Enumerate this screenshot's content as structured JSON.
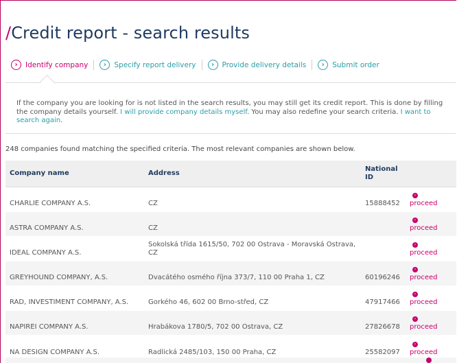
{
  "page": {
    "title_slash": "/",
    "title": "Credit report - search results"
  },
  "steps": [
    {
      "label": "Identify company",
      "icon": "chevron-right-circle-icon",
      "active": true
    },
    {
      "label": "Specify report delivery",
      "icon": "chevron-right-circle-icon",
      "active": false
    },
    {
      "label": "Provide delivery details",
      "icon": "chevron-right-circle-icon",
      "active": false
    },
    {
      "label": "Submit order",
      "icon": "chevron-right-circle-icon",
      "active": false
    }
  ],
  "notice": {
    "text1": "If the company you are looking for is not listed in the search results, you may still get its credit report. This is done by filling the company details yourself. ",
    "link1": "I will provide company details myself",
    "text2": ". You may also redefine your search criteria. ",
    "link2": "I want to search again",
    "text3": "."
  },
  "summary": "248 companies found matching the specified criteria. The most relevant companies are shown below.",
  "table": {
    "headers": {
      "name": "Company name",
      "address": "Address",
      "national_id": "National ID"
    },
    "rows": [
      {
        "name": "CHARLIE COMPANY A.S.",
        "address": "CZ",
        "national_id": "15888452",
        "action": "proceed"
      },
      {
        "name": "ASTRA COMPANY A.S.",
        "address": "CZ",
        "national_id": "",
        "action": "proceed"
      },
      {
        "name": "IDEAL COMPANY A.S.",
        "address": "Sokolská třída 1615/50, 702 00 Ostrava - Moravská Ostrava, CZ",
        "national_id": "",
        "action": "proceed"
      },
      {
        "name": "GREYHOUND COMPANY, A.S.",
        "address": "Dvacátého osmého října 373/7, 110 00 Praha 1, CZ",
        "national_id": "60196246",
        "action": "proceed"
      },
      {
        "name": "RAD, INVESTIMENT COMPANY, A.S.",
        "address": "Gorkého 46, 602 00 Brno-střed, CZ",
        "national_id": "47917466",
        "action": "proceed"
      },
      {
        "name": "NAPIREI COMPANY A.S.",
        "address": "Hrabákova 1780/5, 702 00 Ostrava, CZ",
        "national_id": "27826678",
        "action": "proceed"
      },
      {
        "name": "NA DESIGN COMPANY A.S.",
        "address": "Radlická 2485/103, 150 00 Praha, CZ",
        "national_id": "25582097",
        "action": "proceed"
      }
    ]
  },
  "colors": {
    "accent": "#c6006e",
    "link": "#2a9da7",
    "title": "#1f3a5f"
  }
}
